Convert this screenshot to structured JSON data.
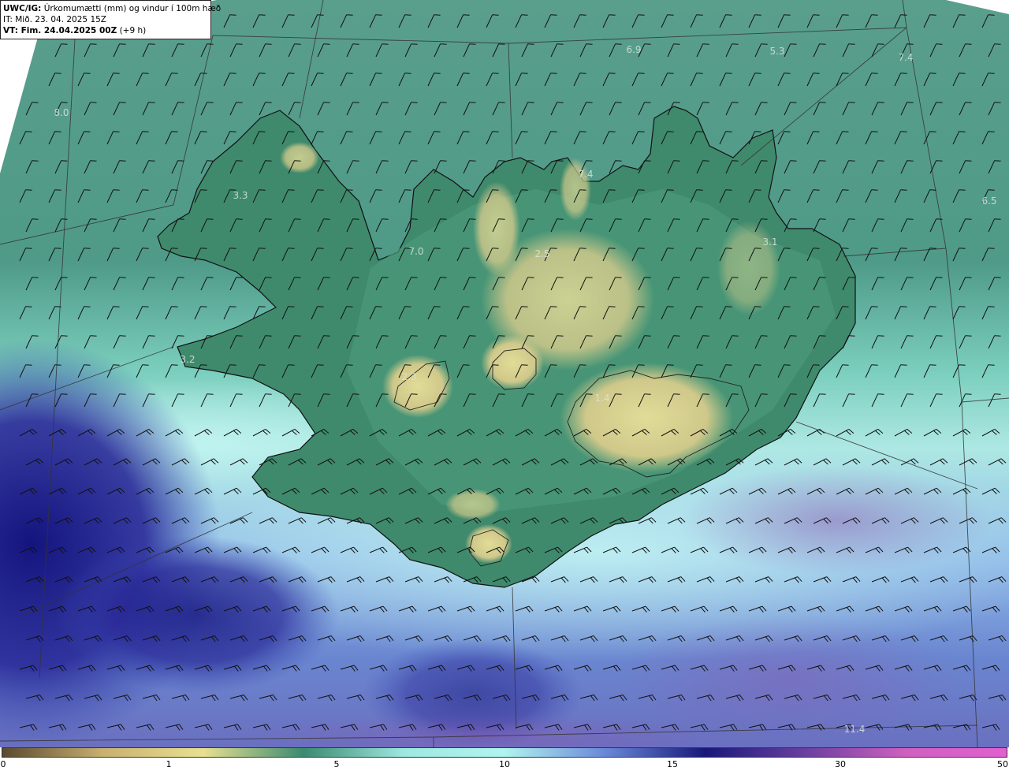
{
  "header": {
    "model": "UWC/IG:",
    "product": "Úrkomumætti (mm) og vindur í 100m hæð",
    "issue_time": "IT: Mið. 23. 04. 2025 15Z",
    "valid_prefix": "VT: Fim. 24.04.2025 00Z",
    "valid_suffix": "(+9 h)"
  },
  "colorbar": {
    "ticks": [
      {
        "label": "0",
        "value": 0
      },
      {
        "label": "1",
        "value": 1
      },
      {
        "label": "5",
        "value": 5
      },
      {
        "label": "10",
        "value": 10
      },
      {
        "label": "15",
        "value": 15
      },
      {
        "label": "30",
        "value": 30
      },
      {
        "label": "50",
        "value": 50
      }
    ],
    "colors": [
      "#5a4a30",
      "#c8b070",
      "#e8e090",
      "#3a8a70",
      "#9ee8e0",
      "#b0f4f0",
      "#6a88d8",
      "#18187a",
      "#6a40a0",
      "#d060c0",
      "#e060d0"
    ]
  },
  "station_values": [
    {
      "id": "nw-sea",
      "text": "8.0"
    },
    {
      "id": "westfjords",
      "text": "3.3"
    },
    {
      "id": "north-sea-1",
      "text": "6.9"
    },
    {
      "id": "north-sea-2",
      "text": "5.3"
    },
    {
      "id": "northeast-sea",
      "text": "7.4"
    },
    {
      "id": "east-sea",
      "text": "6.5"
    },
    {
      "id": "north-coast",
      "text": "7.4"
    },
    {
      "id": "northwest-inland",
      "text": "7.0"
    },
    {
      "id": "central-north",
      "text": "2.5"
    },
    {
      "id": "east-inland",
      "text": "3.1"
    },
    {
      "id": "snaefellsnes",
      "text": "3.2"
    },
    {
      "id": "west-highland",
      "text": "2.3"
    },
    {
      "id": "vatnajokull",
      "text": "1.4"
    },
    {
      "id": "south-sea",
      "text": "11.4"
    }
  ],
  "colors": {
    "sea_green": "#4f9a88",
    "land_green": "#3f8a6c",
    "highland_yellow": "#cfc88a",
    "precip_cyan": "#aee8e4",
    "precip_blue": "#6a86d0",
    "precip_dark": "#1c1c88",
    "precip_purple": "#7a5aa8",
    "coastline": "#111111",
    "barb": "#111111"
  },
  "icons": {
    "wind": "wind-barb-icon"
  }
}
